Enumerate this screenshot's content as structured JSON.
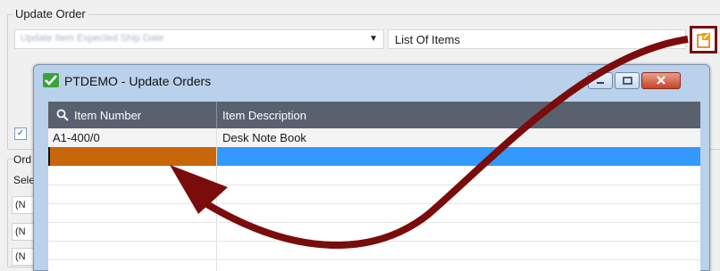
{
  "update_order": {
    "group_title": "Update Order",
    "combo_value": "Update Item Expected Ship Date",
    "list_field": "List Of Items",
    "zoom_icon": "zoom-lookup-icon"
  },
  "left_panel": {
    "checkbox_checked": true,
    "labels": [
      "Ord",
      "Sele"
    ],
    "rows": [
      "(N",
      "(N",
      "(N"
    ]
  },
  "dialog": {
    "title": "PTDEMO - Update Orders",
    "icon": "sage-check-icon",
    "controls": [
      "minimize-icon",
      "maximize-icon",
      "close-icon"
    ],
    "columns": [
      "Item Number",
      "Item Description"
    ],
    "rows": [
      {
        "item_number": "A1-400/0",
        "item_description": "Desk Note Book"
      },
      {
        "item_number": "",
        "item_description": ""
      }
    ]
  },
  "colors": {
    "annotation_arrow": "#7a0c0c",
    "grid_header": "#59616f",
    "selected_row": "#3399ff",
    "active_cell": "#c8660a"
  }
}
